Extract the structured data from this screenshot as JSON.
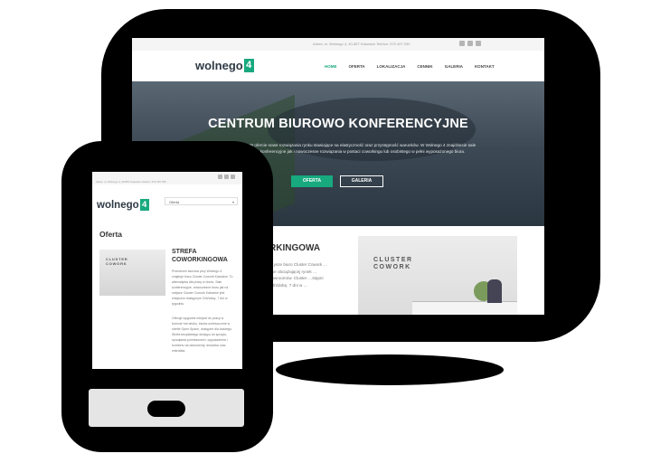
{
  "desktop": {
    "topbar": {
      "info": "Adres: ul. Wolnego 4, 40-857 Katowice      Telefon: 570 497 030",
      "social_icons": [
        "facebook-icon",
        "linkedin-icon",
        "google-plus-icon"
      ]
    },
    "logo": {
      "text": "wolnego",
      "number": "4"
    },
    "menu": [
      "HOME",
      "OFERTA",
      "LOKALIZACJA",
      "CENNIK",
      "GALERIA",
      "KONTAKT"
    ],
    "active_menu": "HOME",
    "hero": {
      "title": "CENTRUM BIUROWO KONFERENCYJNE",
      "text": "W ofercie nowe rozwiązania rynku stawiające na elastyczność oraz przystępność warunków. W Wolnego 4 znajdziecie sale konferencyjne jak i nowoczesne rozwiązania w postaci coworkingu lub osobistego w pełni wyposażonego biura.",
      "btn_primary": "OFERTA",
      "btn_secondary": "GALERIA"
    },
    "section": {
      "title": "RKINGOWA",
      "text": "…ysze biuro Cluster Cowork …nne obciążającej rynek …cowroomów. Cluster …stępni 24h/dobę, 7 dni w …"
    },
    "photo_sign": "CLUSTER\nCOWORK"
  },
  "mobile": {
    "topbar": {
      "info": "Adres: ul. Wolnego 4, 40-857 Katowice      Telefon: 570 497 030",
      "social_icons": [
        "facebook-icon",
        "linkedin-icon",
        "google-plus-icon"
      ]
    },
    "logo": {
      "text": "wolnego",
      "number": "4"
    },
    "select_value": "Oferta",
    "heading": "Oferta",
    "subheading": "STREFA COWORKINGOWA",
    "text1": "Przestrzeń biurowa przy Wolnego 4 znajduje biuro Cluster Cowork Katowice. To alternatywa dla pracy w domu. Sale konferencyjne, nowoczesne biuro jak na miejsce Cluster Cowork Katowice jest miejscem dostępnym 24h/dobę, 7 dni w tygodniu.",
    "text2": "Oferuje wygodne miejsce do pracy w formule hot desku, biurka umieszczone w strefie Open Space, dostępne dla każdego. Strefa bezpłatnego dostępu do sprzętu, sprzątania pomieszczeń, wyposażenia i komfortu na dokumenty, drukarka oraz mikrofala.",
    "photo_sign": "CLUSTER\nCOWORK"
  },
  "colors": {
    "accent": "#18a97f",
    "dark": "#2f3a45",
    "device": "#000000"
  }
}
